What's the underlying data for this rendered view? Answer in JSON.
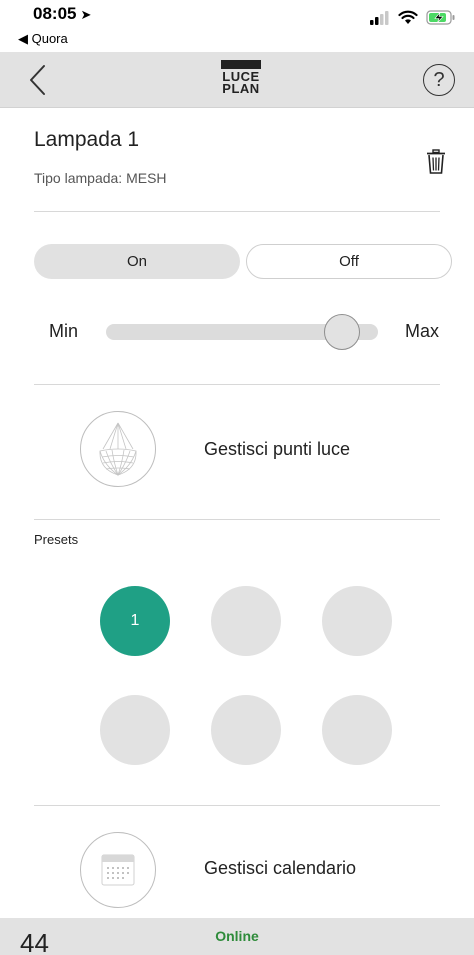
{
  "status_bar": {
    "time": "08:05",
    "location_arrow": "➤",
    "back_app": "◀ Quora"
  },
  "nav": {
    "logo_line1": "LUCE",
    "logo_line2": "PLAN",
    "help_symbol": "?"
  },
  "lamp": {
    "name": "Lampada 1",
    "type_text": "Tipo lampada: MESH"
  },
  "power": {
    "on_label": "On",
    "off_label": "Off",
    "selected": "On"
  },
  "brightness": {
    "min_label": "Min",
    "max_label": "Max",
    "level": 0.93
  },
  "features": {
    "lights_label": "Gestisci punti luce",
    "calendar_label": "Gestisci calendario"
  },
  "presets": {
    "title": "Presets",
    "items": [
      {
        "label": "1",
        "active": true
      },
      {
        "label": "",
        "active": false
      },
      {
        "label": "",
        "active": false
      },
      {
        "label": "",
        "active": false
      },
      {
        "label": "",
        "active": false
      },
      {
        "label": "",
        "active": false
      }
    ],
    "active_color": "#1fa085",
    "inactive_color": "#e2e2e2"
  },
  "footer": {
    "count": "44",
    "status": "Online",
    "status_color": "#2e8b3a"
  }
}
